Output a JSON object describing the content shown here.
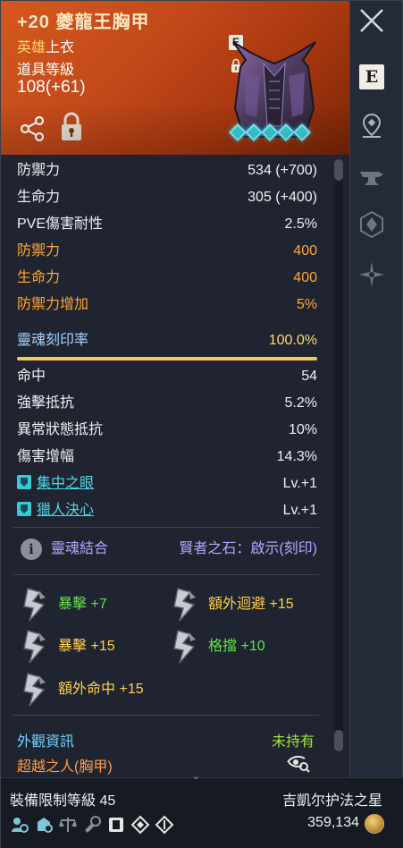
{
  "header": {
    "item_name": "+20 夔龍王胸甲",
    "grade_prefix": "英雄",
    "grade_slot": "上衣",
    "item_level_label": "道具等級",
    "item_level_value": "108(+61)",
    "e_badge": "E"
  },
  "rail": {
    "e_label": "E"
  },
  "stats": [
    {
      "label": "防禦力",
      "value": "534 (+700)",
      "color": "white"
    },
    {
      "label": "生命力",
      "value": "305 (+400)",
      "color": "white"
    },
    {
      "label": "PVE傷害耐性",
      "value": "2.5%",
      "color": "white"
    },
    {
      "label": "防禦力",
      "value": "400",
      "color": "orange"
    },
    {
      "label": "生命力",
      "value": "400",
      "color": "orange"
    },
    {
      "label": "防禦力增加",
      "value": "5%",
      "color": "orange"
    }
  ],
  "soul_imprint": {
    "label": "靈魂刻印率",
    "value": "100.0%",
    "fill": 1.0
  },
  "sub_stats": [
    {
      "label": "命中",
      "value": "54"
    },
    {
      "label": "強擊抵抗",
      "value": "5.2%"
    },
    {
      "label": "異常狀態抵抗",
      "value": "10%"
    },
    {
      "label": "傷害增幅",
      "value": "14.3%"
    }
  ],
  "skills": [
    {
      "label": "集中之眼",
      "value": "Lv.+1"
    },
    {
      "label": "獵人決心",
      "value": "Lv.+1"
    }
  ],
  "soul_bond": {
    "label": "靈魂結合",
    "value": "賢者之石：啟示(刻印)"
  },
  "engravings": [
    {
      "name": "暴擊",
      "bonus": "+7",
      "color": "#63e14d"
    },
    {
      "name": "額外迴避",
      "bonus": "+15",
      "color": "#ffd24a"
    },
    {
      "name": "暴擊",
      "bonus": "+15",
      "color": "#ffd24a"
    },
    {
      "name": "格擋",
      "bonus": "+10",
      "color": "#63e14d"
    },
    {
      "name": "額外命中",
      "bonus": "+15",
      "color": "#ffd24a"
    }
  ],
  "appearance": {
    "label": "外觀資訊",
    "status": "未持有",
    "name": "超越之人(胸甲)"
  },
  "footer": {
    "requirement": "裝備限制等級 45",
    "server": "吉凱尔护法之星",
    "price": "359,134"
  },
  "colors": {
    "header_orange": "#c2481a",
    "accent_gold": "#f6c75f",
    "stat_orange": "#ffa733",
    "skill_cyan": "#4fd7e8",
    "soul_purple": "#b8a6ff"
  }
}
